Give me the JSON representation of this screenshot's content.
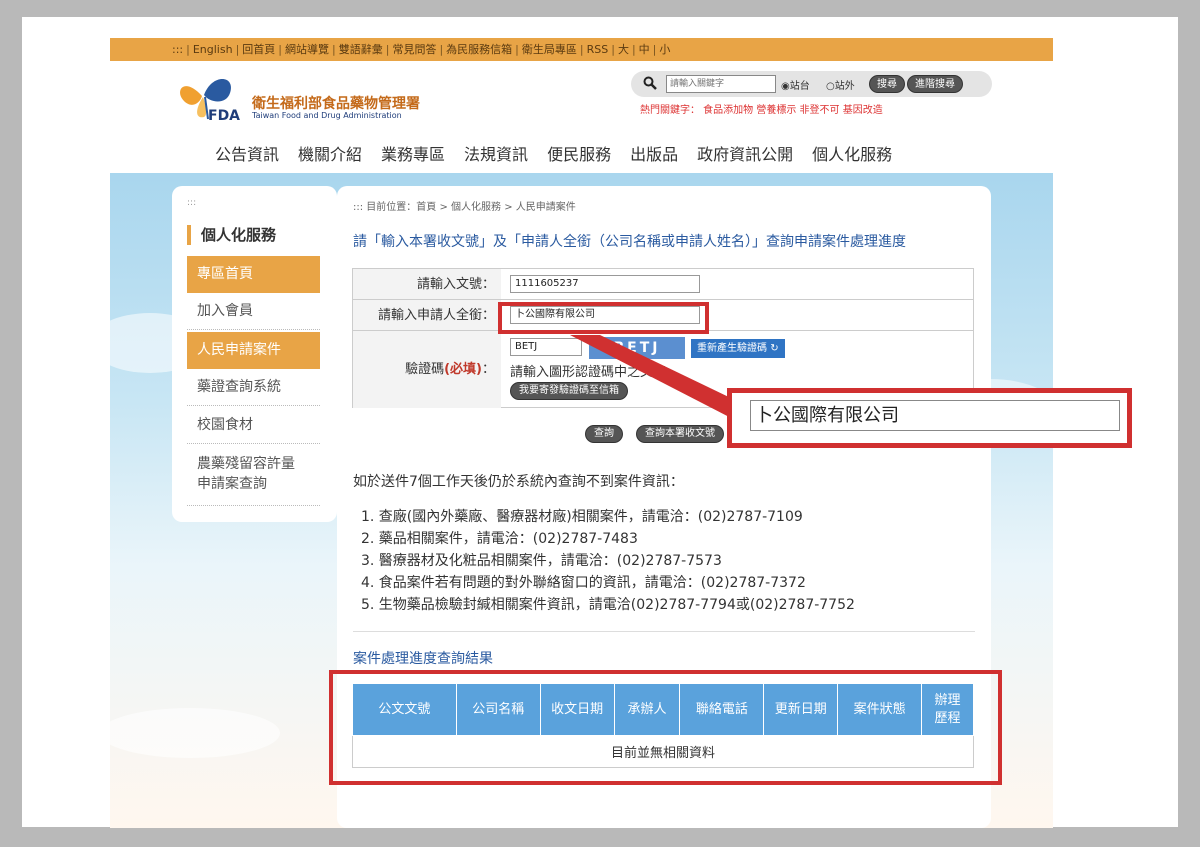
{
  "topbar": {
    "links": [
      ":::",
      "English",
      "回首頁",
      "網站導覽",
      "雙語辭彙",
      "常見問答",
      "為民服務信箱",
      "衛生局專區",
      "RSS",
      "大",
      "中",
      "小"
    ]
  },
  "logo": {
    "fda_text": "FDA",
    "name_cn": "衛生福利部食品藥物管理署",
    "name_en": "Taiwan Food and Drug Administration"
  },
  "search": {
    "placeholder": "請輸入關鍵字",
    "radio_site": "站台",
    "radio_external": "站外",
    "search_button": "搜尋",
    "advanced_button": "進階搜尋",
    "hotwords": "熱門關鍵字： 食品添加物 營養標示 非登不可 基因改造"
  },
  "main_nav": [
    "公告資訊",
    "機關介紹",
    "業務專區",
    "法規資訊",
    "便民服務",
    "出版品",
    "政府資訊公開",
    "個人化服務"
  ],
  "sidebar": {
    "dots": ":::",
    "title": "個人化服務",
    "items": [
      {
        "label": "專區首頁",
        "active": true
      },
      {
        "label": "加入會員",
        "active": false
      },
      {
        "label": "人民申請案件",
        "active": true
      },
      {
        "label": "藥證查詢系統",
        "active": false
      },
      {
        "label": "校園食材",
        "active": false
      },
      {
        "label": "農藥殘留容許量\n申請案查詢",
        "active": false
      }
    ]
  },
  "content": {
    "breadcrumb": "::: 目前位置：首頁 > 個人化服務 > 人民申請案件",
    "instruction": "請「輸入本署收文號」及「申請人全銜（公司名稱或申請人姓名）」查詢申請案件處理進度",
    "form": {
      "doc_no_label": "請輸入文號：",
      "doc_no_value": "1111605237",
      "applicant_label": "請輸入申請人全銜：",
      "applicant_value": "卜公國際有限公司",
      "captcha_label": "驗證碼",
      "captcha_required": "(必填)",
      "captcha_colon": "：",
      "captcha_value": "BETJ",
      "captcha_image_text": "BETJ",
      "regenerate_button": "重新產生驗證碼",
      "captcha_hint": "請輸入圖形認證碼中之文字",
      "email_captcha_button": "我要寄發驗證碼至信箱",
      "query_button": "查詢",
      "query_doc_button": "查詢本署收文號"
    },
    "notice_title": "如於送件7個工作天後仍於系統內查詢不到案件資訊：",
    "notice_items": [
      "1. 查廠(國內外藥廠、醫療器材廠)相關案件，請電洽：(02)2787-7109",
      "2. 藥品相關案件，請電洽：(02)2787-7483",
      "3. 醫療器材及化粧品相關案件，請電洽：(02)2787-7573",
      "4. 食品案件若有問題的對外聯絡窗口的資訊，請電洽：(02)2787-7372",
      "5. 生物藥品檢驗封緘相關案件資訊，請電洽(02)2787-7794或(02)2787-7752"
    ],
    "result_title": "案件處理進度查詢結果",
    "table_headers": [
      "公文文號",
      "公司名稱",
      "收文日期",
      "承辦人",
      "聯絡電話",
      "更新日期",
      "案件狀態",
      "辦理歷程"
    ],
    "no_data": "目前並無相關資料"
  },
  "zoom_callout": {
    "value": "卜公國際有限公司"
  },
  "colors": {
    "topbar": "#e8a446",
    "table_header": "#5aa2dc",
    "highlight": "#d03030"
  }
}
